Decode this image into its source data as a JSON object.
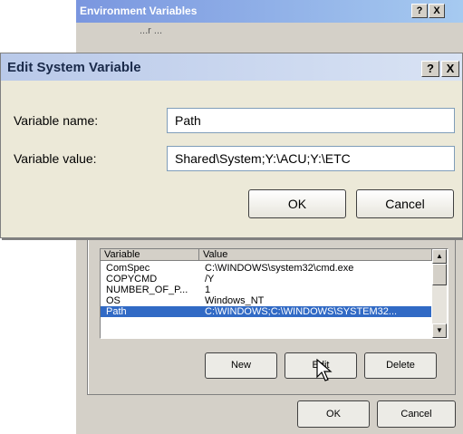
{
  "env_window": {
    "title": "Environment Variables",
    "help_label": "?",
    "close_label": "X",
    "behind_text": "...r ...",
    "list": {
      "columns": [
        "Variable",
        "Value"
      ],
      "rows": [
        {
          "variable": "ComSpec",
          "value": "C:\\WINDOWS\\system32\\cmd.exe"
        },
        {
          "variable": "COPYCMD",
          "value": "/Y"
        },
        {
          "variable": "NUMBER_OF_P...",
          "value": "1"
        },
        {
          "variable": "OS",
          "value": "Windows_NT"
        },
        {
          "variable": "Path",
          "value": "C:\\WINDOWS;C:\\WINDOWS\\SYSTEM32...",
          "selected": true
        }
      ]
    },
    "buttons": {
      "new": "New",
      "edit": "Edit",
      "delete": "Delete",
      "ok": "OK",
      "cancel": "Cancel"
    }
  },
  "edit_dialog": {
    "title": "Edit System Variable",
    "help_label": "?",
    "close_label": "X",
    "name_label": "Variable name:",
    "value_label": "Variable value:",
    "name_value": "Path",
    "value_value": "Shared\\System;Y:\\ACU;Y:\\ETC",
    "ok": "OK",
    "cancel": "Cancel"
  },
  "colors": {
    "selection": "#316ac5",
    "dialog_bg": "#ece9d8",
    "window_bg": "#d4d0c8"
  },
  "icons": [
    "help-icon",
    "close-icon",
    "mouse-pointer-icon",
    "scroll-up-icon",
    "scroll-down-icon"
  ]
}
